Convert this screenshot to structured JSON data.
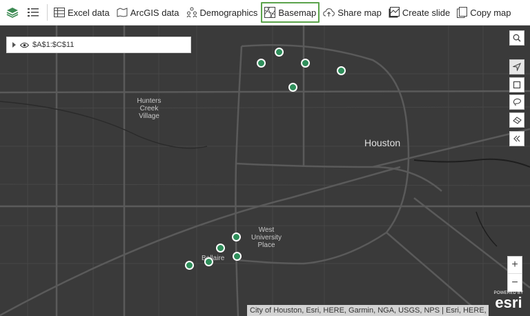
{
  "toolbar": {
    "buttons": [
      {
        "label": "Excel data"
      },
      {
        "label": "ArcGIS data"
      },
      {
        "label": "Demographics"
      },
      {
        "label": "Basemap"
      },
      {
        "label": "Share map"
      },
      {
        "label": "Create slide"
      },
      {
        "label": "Copy map"
      }
    ],
    "active_button": "Basemap",
    "accent_color": "#5ba34b"
  },
  "layer_panel": {
    "label": "$A$1:$C$11"
  },
  "map": {
    "background_color": "#3a3a3a",
    "point_color": "#2f8f5b",
    "labels": {
      "city": "Houston",
      "hunters": [
        "Hunters",
        "Creek",
        "Village"
      ],
      "west_u": [
        "West",
        "University",
        "Place"
      ],
      "bellaire": "Bellaire"
    },
    "zoom": {
      "in": "+",
      "out": "−"
    },
    "attribution": "City of Houston, Esri, HERE, Garmin, NGA, USGS, NPS | Esri, HERE, N...",
    "esri": {
      "powered_by": "POWERED BY",
      "logo": "esri"
    }
  },
  "controls": [
    "search-icon",
    "navigate-icon",
    "rectangle-select-icon",
    "lasso-select-icon",
    "eraser-icon",
    "collapse-icon"
  ]
}
